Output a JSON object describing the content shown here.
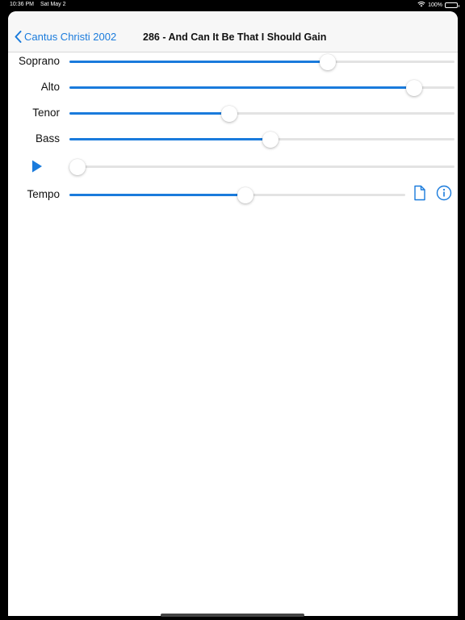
{
  "status_bar": {
    "time": "10:36 PM",
    "date": "Sat May 2",
    "battery": "100%",
    "icons": [
      "wifi-icon",
      "battery-icon"
    ]
  },
  "nav": {
    "back_label": "Cantus Christi 2002",
    "title": "286 - And Can It Be That I Should Gain"
  },
  "sliders": [
    {
      "label": "Soprano",
      "value": 0.65
    },
    {
      "label": "Alto",
      "value": 0.875
    },
    {
      "label": "Tenor",
      "value": 0.395
    },
    {
      "label": "Bass",
      "value": 0.5
    }
  ],
  "playback": {
    "icon": "play-icon",
    "position": 0.0
  },
  "tempo": {
    "label": "Tempo",
    "value": 0.5,
    "icons": [
      "document-icon",
      "info-icon"
    ]
  },
  "colors": {
    "accent": "#1a7bdc",
    "track": "#e3e3e3"
  }
}
